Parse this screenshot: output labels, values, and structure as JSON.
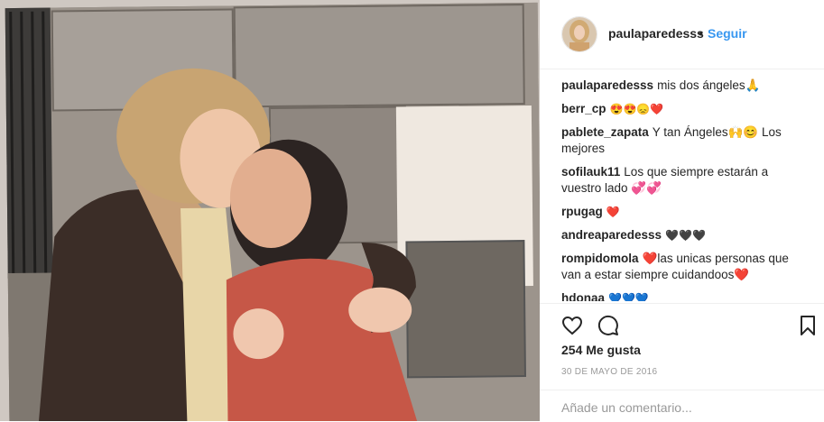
{
  "header": {
    "username": "paulaparedesss",
    "separator": "•",
    "follow_label": "Seguir"
  },
  "comments": [
    {
      "user": "paulaparedesss",
      "text": "mis dos ángeles🙏"
    },
    {
      "user": "berr_cp",
      "text": "😍😍😞❤️"
    },
    {
      "user": "pablete_zapata",
      "text": "Y tan Ángeles🙌😊 Los mejores"
    },
    {
      "user": "sofilauk11",
      "text": "Los que siempre estarán a vuestro lado 💞💞"
    },
    {
      "user": "rpugag",
      "text": "❤️"
    },
    {
      "user": "andreaparedesss",
      "text": "🖤🖤🖤"
    },
    {
      "user": "rompidomola",
      "text": "❤️las unicas personas que van a estar siempre cuidandoos❤️"
    },
    {
      "user": "hdonaa",
      "text": "💙💙💙"
    }
  ],
  "likes": "254 Me gusta",
  "date": "30 DE MAYO DE 2016",
  "add_comment": {
    "placeholder": "Añade un comentario..."
  },
  "icons": {
    "like": "heart-icon",
    "comment": "comment-icon",
    "save": "bookmark-icon"
  },
  "colors": {
    "link": "#3897f0",
    "text": "#262626",
    "muted": "#999999",
    "border": "#efefef"
  }
}
